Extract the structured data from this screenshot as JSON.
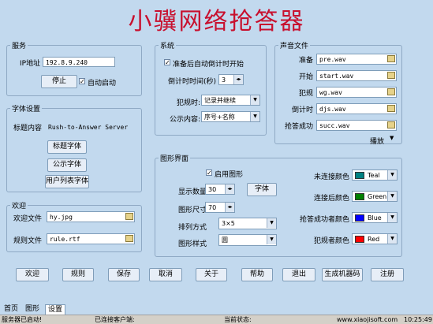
{
  "title": "小骥网络抢答器",
  "service": {
    "caption": "服务",
    "ip_label": "IP地址",
    "ip_value": "192.8.9.240",
    "stop_label": "停止",
    "autostart_label": "自动启动"
  },
  "font_settings": {
    "caption": "字体设置",
    "title_label": "标题内容",
    "title_value": "Rush-to-Answer Server",
    "title_font_btn": "标题字体",
    "notice_font_btn": "公示字体",
    "userlist_font_btn": "用户列表字体"
  },
  "welcome": {
    "caption": "欢迎",
    "welcome_file_label": "欢迎文件",
    "welcome_file_value": "hy.jpg",
    "rule_file_label": "规则文件",
    "rule_file_value": "rule.rtf"
  },
  "system": {
    "caption": "系统",
    "autocountdown_label": "准备后自动倒计时开始",
    "countdown_label": "倒计时时间(秒)",
    "countdown_value": "3",
    "violation_label": "犯规时:",
    "violation_value": "记录并继续",
    "notice_label": "公示内容:",
    "notice_value": "序号+名称"
  },
  "sound": {
    "caption": "声音文件",
    "items": [
      {
        "label": "准备",
        "value": "pre.wav"
      },
      {
        "label": "开始",
        "value": "start.wav"
      },
      {
        "label": "犯规",
        "value": "wg.wav"
      },
      {
        "label": "倒计时",
        "value": "djs.wav"
      },
      {
        "label": "抢答成功",
        "value": "succ.wav"
      }
    ],
    "play_label": "播放"
  },
  "graphics": {
    "caption": "图形界面",
    "enable_label": "启用图形",
    "count_label": "显示数量",
    "count_value": "30",
    "font_btn": "字体",
    "size_label": "图形尺寸",
    "size_value": "70",
    "arrange_label": "排列方式",
    "arrange_value": "3×5",
    "style_label": "图形样式",
    "style_value": "圆",
    "colors": [
      {
        "label": "未连接颜色",
        "value": "Teal",
        "hex": "#008080"
      },
      {
        "label": "连接后颜色",
        "value": "Green",
        "hex": "#008000"
      },
      {
        "label": "抢答成功者颜色",
        "value": "Blue",
        "hex": "#0000ff"
      },
      {
        "label": "犯规者颜色",
        "value": "Red",
        "hex": "#ff0000"
      }
    ]
  },
  "bottom_buttons": [
    "欢迎",
    "规则",
    "保存",
    "取消",
    "关于",
    "帮助",
    "退出",
    "生成机器码",
    "注册"
  ],
  "tabs": [
    "首页",
    "图形",
    "设置"
  ],
  "status": {
    "left": "服务器已启动!",
    "mid": "已连接客户端:",
    "state": "当前状态:",
    "url": "www.xiaojisoft.com",
    "time": "10:25:49"
  }
}
